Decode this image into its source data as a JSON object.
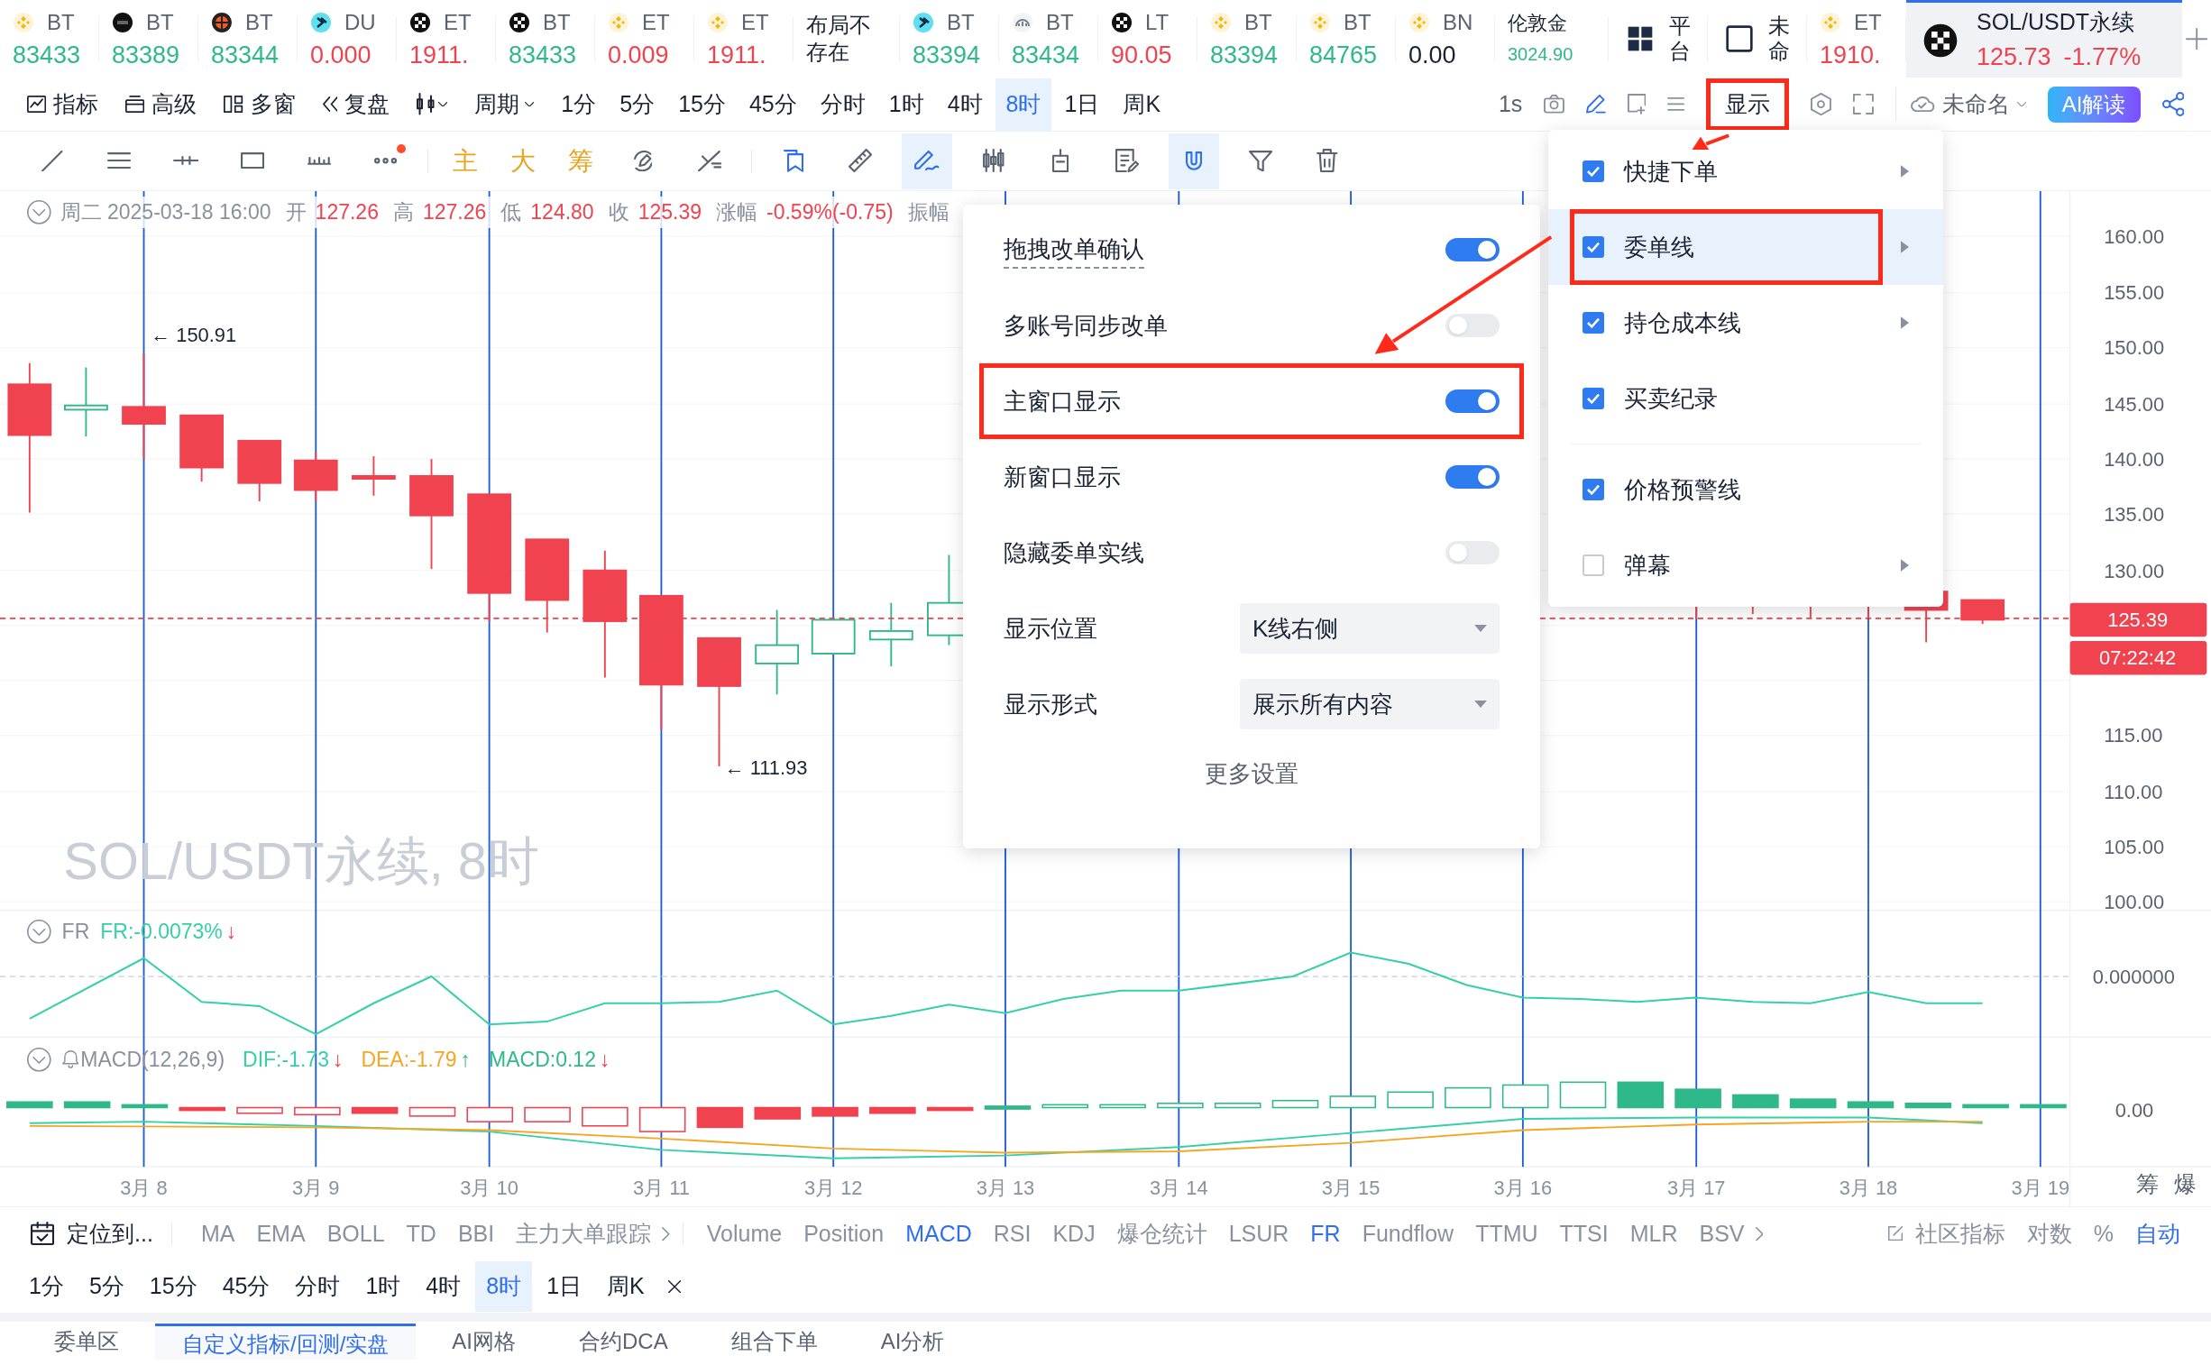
{
  "tickers": [
    {
      "kind": "diamond",
      "name": "BT",
      "price": "83433",
      "color": "#2fb88a"
    },
    {
      "kind": "dark",
      "name": "BT",
      "price": "83389",
      "color": "#2fb88a"
    },
    {
      "kind": "orange",
      "name": "BT",
      "price": "83344",
      "color": "#2fb88a"
    },
    {
      "kind": "cyan",
      "name": "DU",
      "price": "0.000",
      "color": "#f0424f"
    },
    {
      "kind": "checker",
      "name": "ET",
      "price": "1911.",
      "color": "#f0424f"
    },
    {
      "kind": "checker",
      "name": "BT",
      "price": "83433",
      "color": "#2fb88a"
    },
    {
      "kind": "diamond",
      "name": "ET",
      "price": "0.009",
      "color": "#f0424f"
    },
    {
      "kind": "diamond",
      "name": "ET",
      "price": "1911.",
      "color": "#f0424f"
    },
    {
      "kind": "text",
      "name": "布局不存在"
    },
    {
      "kind": "cyan",
      "name": "BT",
      "price": "83394",
      "color": "#2fb88a"
    },
    {
      "kind": "gray",
      "name": "BT",
      "price": "83434",
      "color": "#2fb88a"
    },
    {
      "kind": "checker",
      "name": "LT",
      "price": "90.05",
      "color": "#f0424f"
    },
    {
      "kind": "diamond",
      "name": "BT",
      "price": "83394",
      "color": "#2fb88a"
    },
    {
      "kind": "diamond",
      "name": "BT",
      "price": "84765",
      "color": "#2fb88a"
    },
    {
      "kind": "diamond",
      "name": "BN",
      "price": "0.00",
      "color": "#1a2233"
    },
    {
      "kind": "small",
      "name": "伦敦金",
      "price": "3024.90",
      "color": "#2fb88a"
    },
    {
      "kind": "grid",
      "name": "平台"
    },
    {
      "kind": "square",
      "name": "未命"
    },
    {
      "kind": "diamond",
      "name": "ET",
      "price": "1910.",
      "color": "#f0424f"
    }
  ],
  "active_ticker": {
    "name": "SOL/USDT永续",
    "price": "125.73",
    "change": "-1.77%",
    "selected": true
  },
  "toolbar": {
    "tools": [
      {
        "kind": "chart",
        "label": "指标"
      },
      {
        "kind": "card",
        "label": "高级"
      },
      {
        "kind": "panes",
        "label": "多窗"
      },
      {
        "kind": "rewind",
        "label": "复盘"
      }
    ],
    "period_menu": "周期",
    "periods": [
      {
        "label": "1分",
        "selected": false
      },
      {
        "label": "5分",
        "selected": false
      },
      {
        "label": "15分",
        "selected": false
      },
      {
        "label": "45分",
        "selected": false
      },
      {
        "label": "分时",
        "selected": false
      },
      {
        "label": "1时",
        "selected": false
      },
      {
        "label": "4时",
        "selected": false
      },
      {
        "label": "8时",
        "selected": true
      },
      {
        "label": "1日",
        "selected": false
      },
      {
        "label": "周K",
        "selected": false
      }
    ],
    "interval": "1s",
    "display_button": {
      "label": "显示",
      "annotated": true
    },
    "layout_name": "未命名",
    "ai_button": "AI解读"
  },
  "drawing_tools": [
    {
      "kind": "line",
      "selected": false
    },
    {
      "kind": "parallel",
      "selected": false
    },
    {
      "kind": "hline",
      "selected": false
    },
    {
      "kind": "rect",
      "selected": false
    },
    {
      "kind": "ruler-bar",
      "selected": false
    },
    {
      "kind": "more",
      "selected": false,
      "dot": true
    },
    {
      "kind": "separator"
    },
    {
      "kind": "text",
      "label": "主"
    },
    {
      "kind": "text",
      "label": "大"
    },
    {
      "kind": "text",
      "label": "筹"
    },
    {
      "kind": "rotate",
      "selected": false
    },
    {
      "kind": "cross",
      "selected": false
    },
    {
      "kind": "separator"
    },
    {
      "kind": "bookmark",
      "selected": false
    },
    {
      "kind": "ruler",
      "selected": false
    },
    {
      "kind": "pencil-wave",
      "selected": true
    },
    {
      "kind": "candles",
      "selected": false
    },
    {
      "kind": "bracket",
      "selected": false
    },
    {
      "kind": "note",
      "selected": false
    },
    {
      "kind": "magnet",
      "selected": true
    },
    {
      "kind": "filter",
      "selected": false
    },
    {
      "kind": "trash",
      "selected": false
    }
  ],
  "chart": {
    "info_date": "周二 2025-03-18 16:00",
    "info_fields": [
      {
        "label": "开",
        "value": "127.26"
      },
      {
        "label": "高",
        "value": "127.26"
      },
      {
        "label": "低",
        "value": "124.80"
      },
      {
        "label": "收",
        "value": "125.39"
      },
      {
        "label": "涨幅",
        "value": "-0.59%(-0.75)"
      },
      {
        "label": "振幅"
      }
    ],
    "symbol_label": "SOL/USDT永续, 8时",
    "high_marker": "← 150.91",
    "low_marker": "← 111.93",
    "price_axis": [
      "160.00",
      "155.00",
      "150.00",
      "145.00",
      "140.00",
      "135.00",
      "130.00",
      "115.00",
      "110.00",
      "105.00",
      "100.00"
    ],
    "last_price": "125.39",
    "countdown": "07:22:42",
    "fr": {
      "label": "FR",
      "value": "FR:-0.0073%",
      "arrow": "↓",
      "color": "#f0424f",
      "axis": "0.000000"
    },
    "macd": {
      "label": "MACD(12,26,9)",
      "values": [
        {
          "kind": "dif",
          "text": "DIF:-1.73",
          "arrow": "↓",
          "color": "#f0424f"
        },
        {
          "kind": "dea",
          "text": "DEA:-1.79",
          "arrow": "↑",
          "color": "#2fb88a"
        },
        {
          "kind": "macd",
          "text": "MACD:0.12",
          "arrow": "↓",
          "color": "#f0424f"
        }
      ],
      "axis": "0.00"
    },
    "dates": [
      "3月 8",
      "3月 9",
      "3月 10",
      "3月 11",
      "3月 12",
      "3月 13",
      "3月 14",
      "3月 15",
      "3月 16",
      "3月 17",
      "3月 18",
      "3月 19"
    ],
    "corner": [
      "筹",
      "爆"
    ]
  },
  "settings_panel": {
    "rows": [
      {
        "kind": "toggle",
        "label": "拖拽改单确认",
        "on": true,
        "underlined": true
      },
      {
        "kind": "toggle",
        "label": "多账号同步改单",
        "on": false,
        "underlined": false
      },
      {
        "kind": "toggle",
        "label": "主窗口显示",
        "on": true,
        "underlined": false,
        "annotated": true
      },
      {
        "kind": "toggle",
        "label": "新窗口显示",
        "on": true,
        "underlined": false
      },
      {
        "kind": "toggle",
        "label": "隐藏委单实线",
        "on": false,
        "underlined": false
      },
      {
        "kind": "select",
        "label": "显示位置",
        "value": "K线右侧"
      },
      {
        "kind": "select",
        "label": "显示形式",
        "value": "展示所有内容"
      }
    ],
    "more_link": "更多设置"
  },
  "display_menu": [
    {
      "kind": "item",
      "label": "快捷下单",
      "checked": true,
      "submenu": true,
      "selected": false,
      "annotated": false
    },
    {
      "kind": "item",
      "label": "委单线",
      "checked": true,
      "submenu": true,
      "selected": true,
      "annotated": true
    },
    {
      "kind": "item",
      "label": "持仓成本线",
      "checked": true,
      "submenu": true,
      "selected": false,
      "annotated": false
    },
    {
      "kind": "item",
      "label": "买卖纪录",
      "checked": true,
      "submenu": false,
      "selected": false,
      "annotated": false
    },
    {
      "kind": "divider"
    },
    {
      "kind": "item",
      "label": "价格预警线",
      "checked": true,
      "submenu": false,
      "selected": false,
      "annotated": false
    },
    {
      "kind": "item",
      "label": "弹幕",
      "checked": false,
      "submenu": true,
      "selected": false,
      "annotated": false
    }
  ],
  "indicator_bar": {
    "locate": "定位到...",
    "main": [
      {
        "label": "MA",
        "selected": false
      },
      {
        "label": "EMA",
        "selected": false
      },
      {
        "label": "BOLL",
        "selected": false
      },
      {
        "label": "TD",
        "selected": false
      },
      {
        "label": "BBI",
        "selected": false
      },
      {
        "label": "主力大单跟踪",
        "selected": false
      }
    ],
    "sub": [
      {
        "label": "Volume",
        "selected": false
      },
      {
        "label": "Position",
        "selected": false
      },
      {
        "label": "MACD",
        "selected": true
      },
      {
        "label": "RSI",
        "selected": false
      },
      {
        "label": "KDJ",
        "selected": false
      },
      {
        "label": "爆仓统计",
        "selected": false
      },
      {
        "label": "LSUR",
        "selected": false
      },
      {
        "label": "FR",
        "selected": true
      },
      {
        "label": "Fundflow",
        "selected": false
      },
      {
        "label": "TTMU",
        "selected": false
      },
      {
        "label": "TTSI",
        "selected": false
      },
      {
        "label": "MLR",
        "selected": false
      },
      {
        "label": "BSV",
        "selected": false
      }
    ],
    "community": "社区指标",
    "scale": [
      {
        "label": "对数",
        "selected": false
      },
      {
        "label": "%",
        "selected": false
      },
      {
        "label": "自动",
        "selected": true
      }
    ]
  },
  "period_bar": [
    {
      "label": "1分",
      "selected": false
    },
    {
      "label": "5分",
      "selected": false
    },
    {
      "label": "15分",
      "selected": false
    },
    {
      "label": "45分",
      "selected": false
    },
    {
      "label": "分时",
      "selected": false
    },
    {
      "label": "1时",
      "selected": false
    },
    {
      "label": "4时",
      "selected": false
    },
    {
      "label": "8时",
      "selected": true
    },
    {
      "label": "1日",
      "selected": false
    },
    {
      "label": "周K",
      "selected": false
    }
  ],
  "bottom_tabs": [
    {
      "label": "委单区",
      "selected": false
    },
    {
      "label": "自定义指标/回测/实盘",
      "selected": true
    },
    {
      "label": "AI网格",
      "selected": false
    },
    {
      "label": "合约DCA",
      "selected": false
    },
    {
      "label": "组合下单",
      "selected": false
    },
    {
      "label": "AI分析",
      "selected": false
    }
  ]
}
